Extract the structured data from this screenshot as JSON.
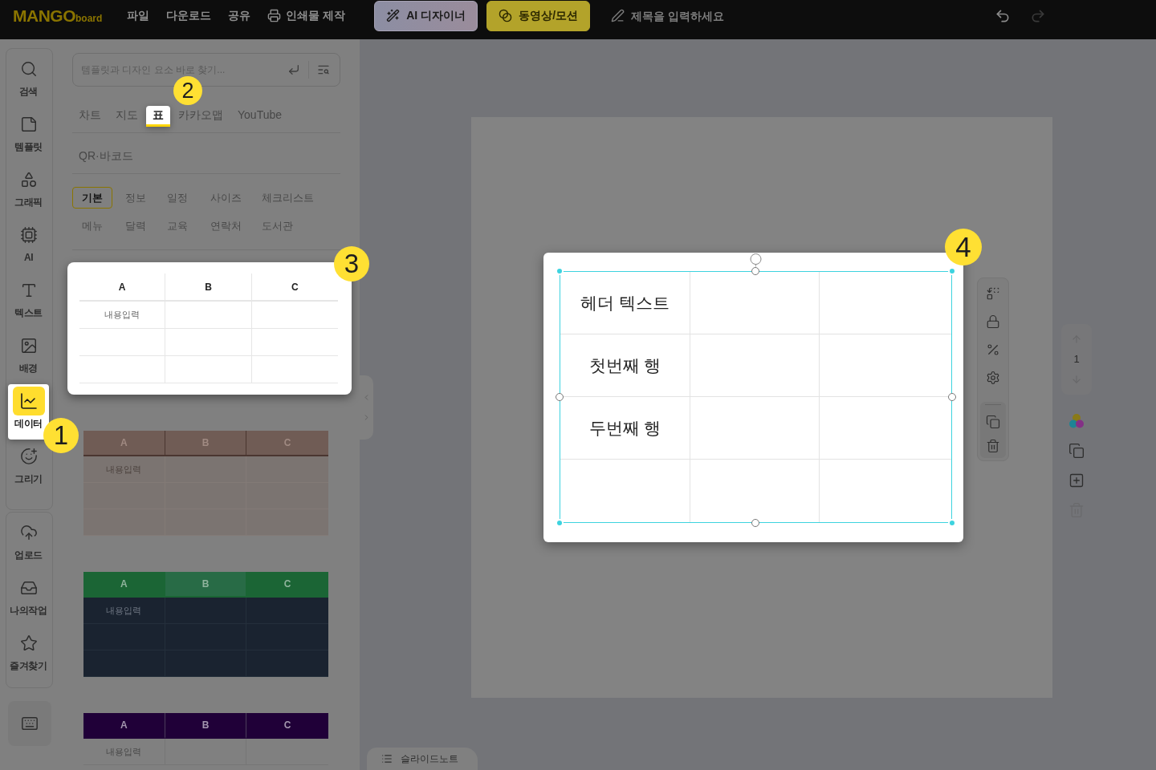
{
  "top_bar": {
    "logo": {
      "main": "MANGO",
      "sub": "board"
    },
    "menu": [
      {
        "label": "파일",
        "kind": "plain"
      },
      {
        "label": "다운로드",
        "kind": "plain"
      },
      {
        "label": "공유",
        "kind": "plain"
      },
      {
        "label": "인쇄물 제작",
        "kind": "print"
      }
    ],
    "actions": [
      {
        "label": "AI 디자이너",
        "kind": "ai"
      },
      {
        "label": "동영상/모션",
        "kind": "motion"
      }
    ],
    "title_field": {
      "placeholder": "제목을 입력하세요"
    },
    "history": [
      {
        "kind": "undo",
        "disabled": false
      },
      {
        "kind": "redo",
        "disabled": true
      }
    ]
  },
  "icon_rail": {
    "groups": [
      {
        "items": [
          {
            "label": "검색",
            "selected": false
          },
          {
            "label": "템플릿",
            "selected": false
          },
          {
            "label": "그래픽",
            "selected": false
          },
          {
            "label": "AI",
            "selected": false
          },
          {
            "label": "텍스트",
            "selected": false
          },
          {
            "label": "배경",
            "selected": false
          },
          {
            "label": "데이터",
            "selected": true,
            "callout": "1"
          },
          {
            "label": "그리기",
            "selected": false
          }
        ]
      },
      {
        "items": [
          {
            "label": "업로드",
            "selected": false
          },
          {
            "label": "나의작업",
            "selected": false
          },
          {
            "label": "즐겨찾기",
            "selected": false
          }
        ]
      }
    ]
  },
  "panel": {
    "search": {
      "placeholder": "템플릿과 디자인 요소 바로 찾기..."
    },
    "tabs": [
      {
        "label": "차트",
        "selected": false
      },
      {
        "label": "지도",
        "selected": false
      },
      {
        "label": "표",
        "selected": true,
        "callout": "2"
      },
      {
        "label": "카카오맵",
        "selected": false
      },
      {
        "label": "YouTube",
        "selected": false
      },
      {
        "label": "QR·바코드",
        "selected": false
      }
    ],
    "categories": [
      {
        "label": "기본",
        "selected": true
      },
      {
        "label": "정보",
        "selected": false
      },
      {
        "label": "일정",
        "selected": false
      },
      {
        "label": "사이즈",
        "selected": false
      },
      {
        "label": "체크리스트",
        "selected": false
      },
      {
        "label": "메뉴",
        "selected": false
      },
      {
        "label": "달력",
        "selected": false
      },
      {
        "label": "교육",
        "selected": false
      },
      {
        "label": "연락처",
        "selected": false
      },
      {
        "label": "도서관",
        "selected": false
      }
    ],
    "templates": [
      {
        "kind": "outline",
        "callout": "3",
        "header": [
          "A",
          "B",
          "C"
        ],
        "rows": [
          [
            "내용입력",
            null,
            null
          ],
          [
            null,
            null,
            null
          ],
          [
            null,
            null,
            null
          ]
        ]
      },
      {
        "kind": "brown",
        "header": [
          "A",
          "B",
          "C"
        ],
        "rows": [
          [
            "내용입력",
            null,
            null
          ],
          [
            null,
            null,
            null
          ],
          [
            null,
            null,
            null
          ]
        ]
      },
      {
        "kind": "green",
        "header": [
          "A",
          "B",
          "C"
        ],
        "rows": [
          [
            "내용입력",
            null,
            null
          ],
          [
            null,
            null,
            null
          ],
          [
            null,
            null,
            null
          ]
        ]
      },
      {
        "kind": "purple",
        "header": [
          "A",
          "B",
          "C"
        ],
        "rows": [
          [
            "내용입력",
            null,
            null
          ]
        ]
      }
    ]
  },
  "canvas": {
    "table": {
      "callout": "4",
      "rows": [
        [
          "헤더 텍스트",
          null,
          null
        ],
        [
          "첫번째 행",
          null,
          null
        ],
        [
          "두번째 행",
          null,
          null
        ],
        [
          null,
          null,
          null
        ]
      ]
    },
    "page_nav": {
      "page": "1"
    },
    "page_tools": [
      {
        "disabled": false
      },
      {
        "disabled": false
      },
      {
        "disabled": false
      },
      {
        "disabled": true
      }
    ],
    "slide_note": {
      "label": "슬라이드노트"
    }
  }
}
